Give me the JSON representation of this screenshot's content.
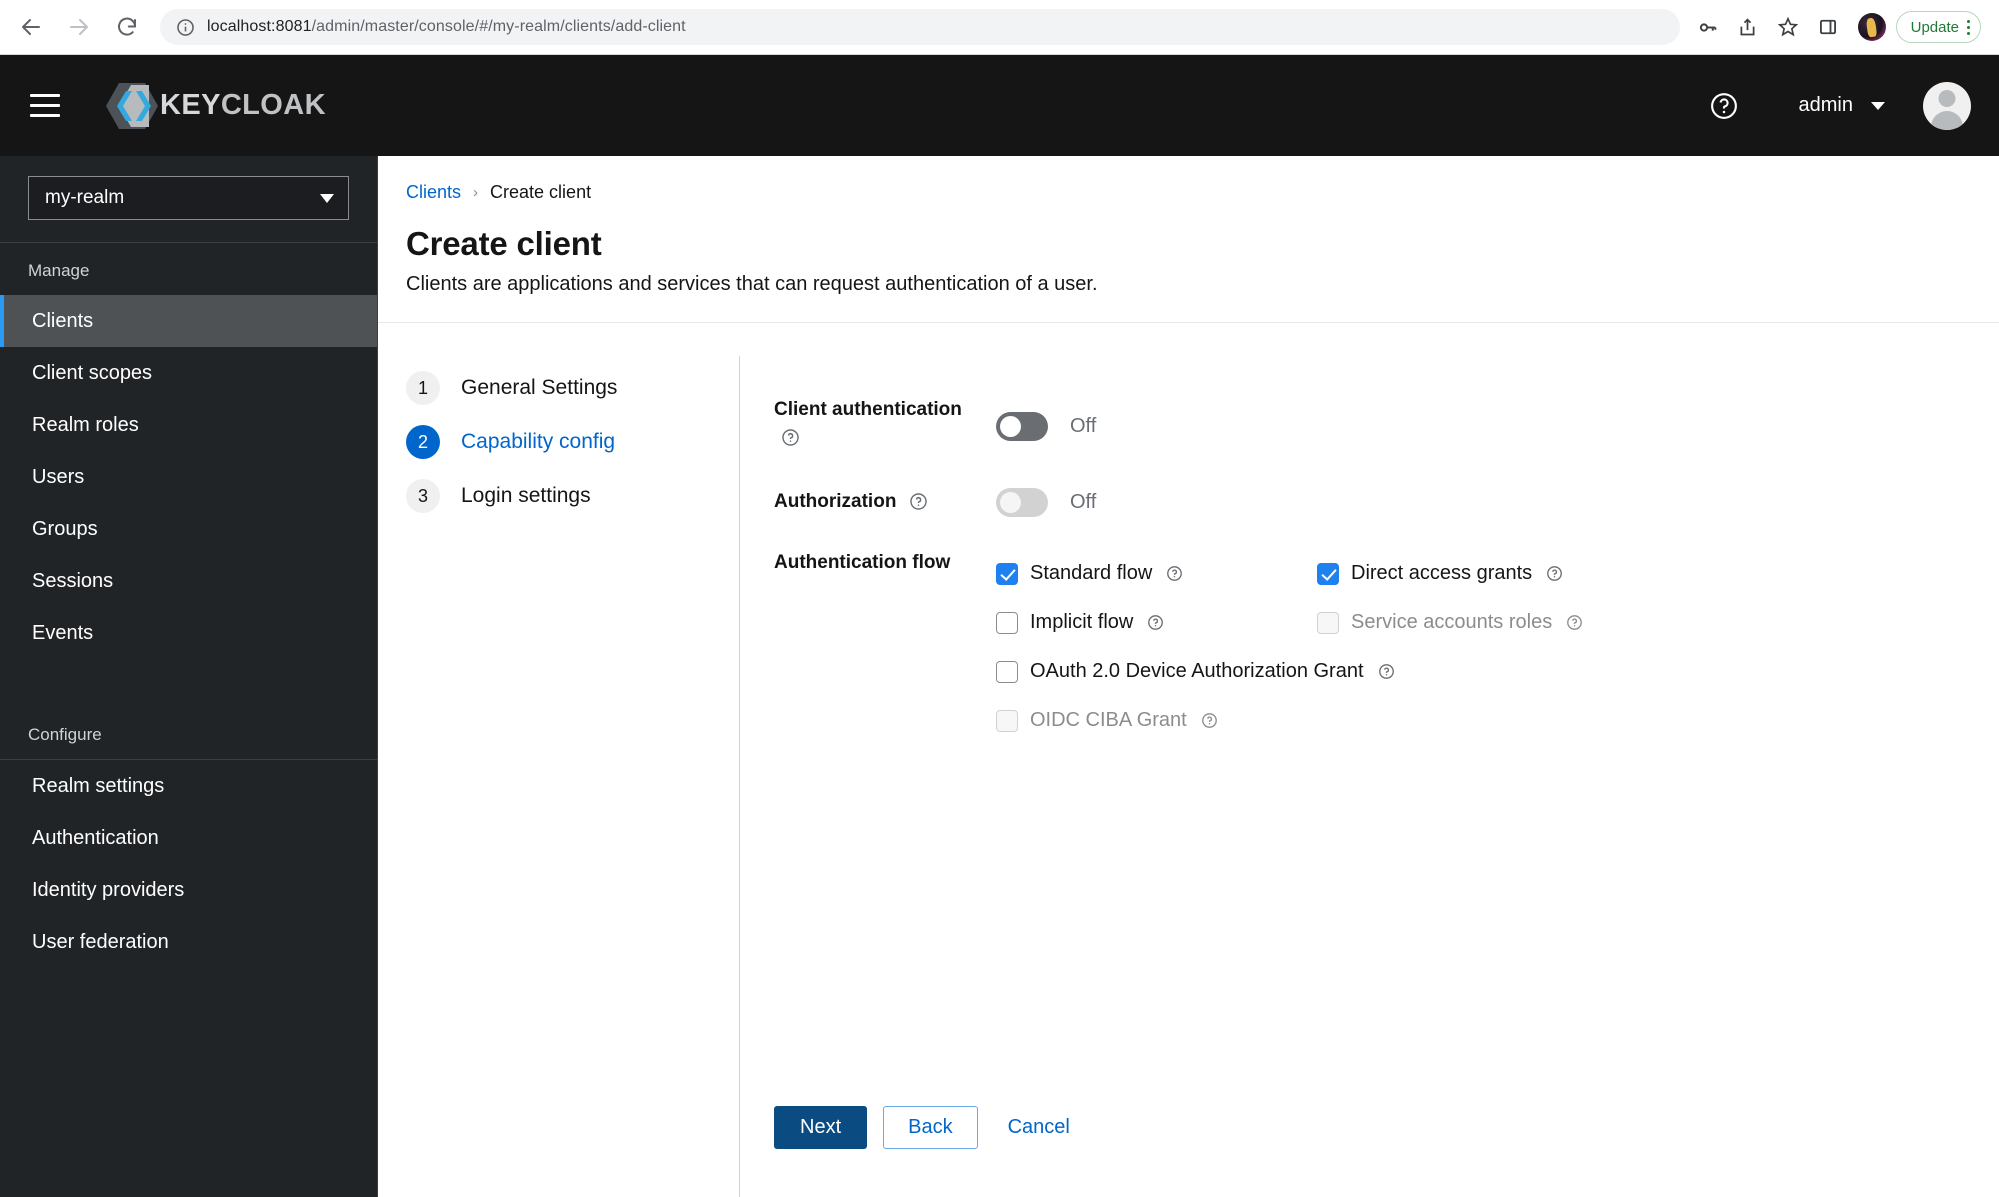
{
  "browser": {
    "url_host": "localhost:8081",
    "url_path": "/admin/master/console/#/my-realm/clients/add-client",
    "back_icon": "back-arrow-icon",
    "forward_icon": "forward-arrow-icon",
    "reload_icon": "reload-icon",
    "info_icon": "site-info-icon",
    "password_icon": "password-key-icon",
    "share_icon": "share-icon",
    "bookmark_icon": "bookmark-star-icon",
    "sidepanel_icon": "side-panel-icon",
    "update_label": "Update",
    "menu_icon": "kebab-menu-icon"
  },
  "masthead": {
    "menu_icon": "hamburger-menu-icon",
    "brand_prefix": "KEY",
    "brand_suffix": "CLOAK",
    "brand_logo_icon": "keycloak-logo-icon",
    "help_icon": "help-question-icon",
    "username": "admin",
    "avatar_icon": "user-avatar-icon"
  },
  "sidebar": {
    "realm": "my-realm",
    "groups": [
      {
        "title": "Manage",
        "items": [
          {
            "label": "Clients",
            "active": true
          },
          {
            "label": "Client scopes",
            "active": false
          },
          {
            "label": "Realm roles",
            "active": false
          },
          {
            "label": "Users",
            "active": false
          },
          {
            "label": "Groups",
            "active": false
          },
          {
            "label": "Sessions",
            "active": false
          },
          {
            "label": "Events",
            "active": false
          }
        ]
      },
      {
        "title": "Configure",
        "items": [
          {
            "label": "Realm settings",
            "active": false
          },
          {
            "label": "Authentication",
            "active": false
          },
          {
            "label": "Identity providers",
            "active": false
          },
          {
            "label": "User federation",
            "active": false
          }
        ]
      }
    ]
  },
  "page": {
    "breadcrumb_root": "Clients",
    "breadcrumb_sep": "›",
    "breadcrumb_current": "Create client",
    "title": "Create client",
    "description": "Clients are applications and services that can request authentication of a user."
  },
  "wizard": {
    "steps": [
      {
        "num": "1",
        "label": "General Settings",
        "active": false
      },
      {
        "num": "2",
        "label": "Capability config",
        "active": true
      },
      {
        "num": "3",
        "label": "Login settings",
        "active": false
      }
    ],
    "fields": {
      "client_auth_label": "Client authentication",
      "client_auth_value": "Off",
      "authorization_label": "Authorization",
      "authorization_value": "Off",
      "auth_flow_label": "Authentication flow"
    },
    "checkboxes": [
      {
        "label": "Standard flow",
        "checked": true,
        "disabled": false
      },
      {
        "label": "Direct access grants",
        "checked": true,
        "disabled": false
      },
      {
        "label": "Implicit flow",
        "checked": false,
        "disabled": false
      },
      {
        "label": "Service accounts roles",
        "checked": false,
        "disabled": true
      },
      {
        "label": "OAuth 2.0 Device Authorization Grant",
        "checked": false,
        "disabled": false
      },
      {
        "label": "OIDC CIBA Grant",
        "checked": false,
        "disabled": true
      }
    ],
    "actions": {
      "next": "Next",
      "back": "Back",
      "cancel": "Cancel"
    }
  },
  "colors": {
    "accent_blue": "#06c",
    "checkbox_blue": "#1f80f0",
    "primary_button": "#0a4b82",
    "sidebar_bg": "#212427",
    "masthead_bg": "#151515"
  }
}
